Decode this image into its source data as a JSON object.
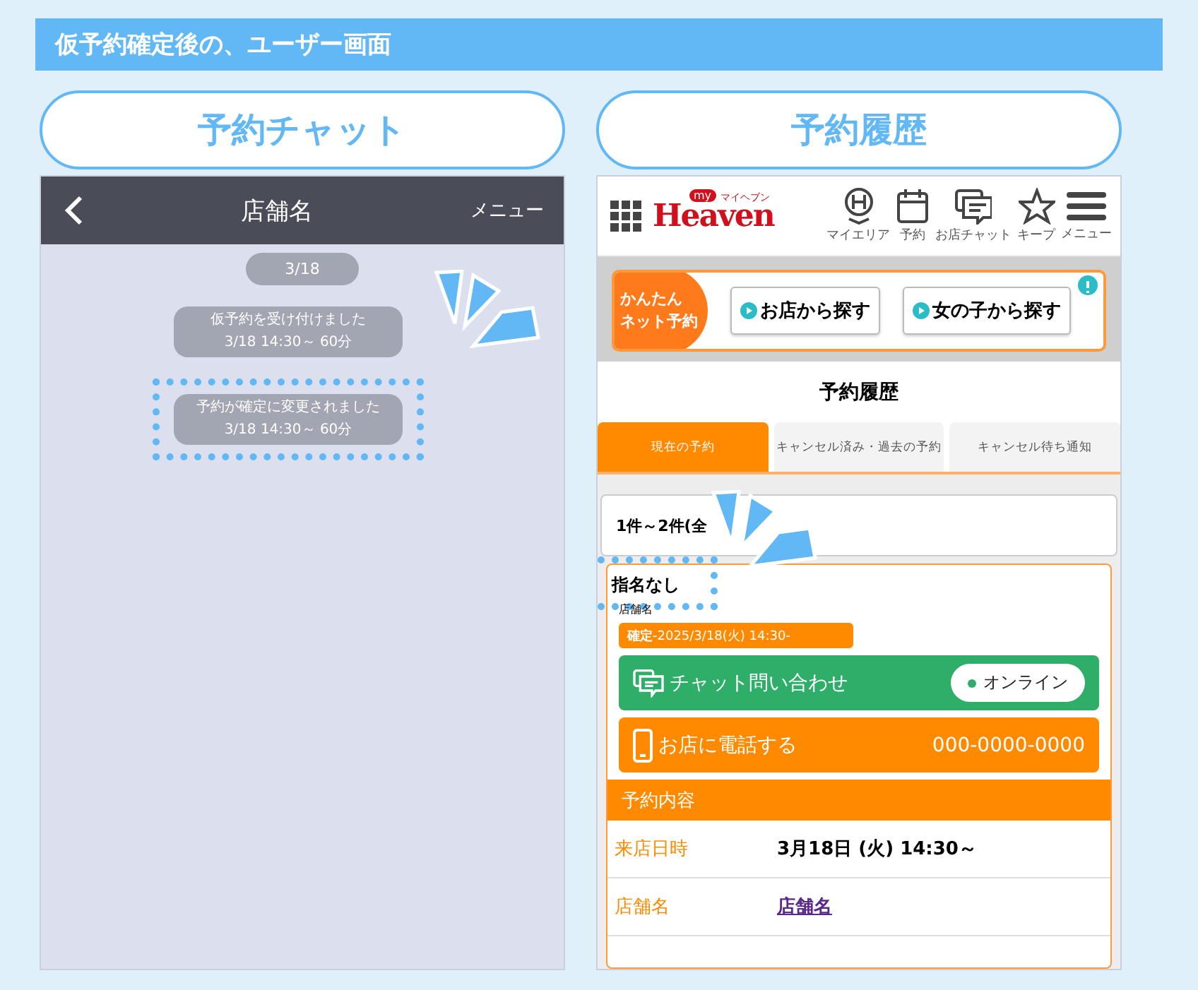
{
  "banner": {
    "title": "仮予約確定後の、ユーザー画面"
  },
  "chat": {
    "heading": "予約チャット",
    "title": "店舗名",
    "menu": "メニュー",
    "date": "3/18",
    "messages": [
      {
        "lines": [
          "仮予約を受け付けました",
          "3/18 14:30～ 60分"
        ],
        "highlighted": false
      },
      {
        "lines": [
          "予約が確定に変更されました",
          "3/18 14:30～ 60分"
        ],
        "highlighted": true
      }
    ]
  },
  "history": {
    "heading": "予約履歴",
    "logo": {
      "small": "my",
      "name": "Heaven",
      "kana": "マイヘブン"
    },
    "nav": [
      {
        "kind": "pin",
        "label": "マイエリア"
      },
      {
        "kind": "calendar",
        "label": "予約"
      },
      {
        "kind": "chat",
        "label": "お店チャット"
      },
      {
        "kind": "star",
        "label": "キープ"
      },
      {
        "kind": "menu",
        "label": "メニュー"
      }
    ],
    "promo": {
      "badge": [
        "かんたん",
        "ネット予約"
      ],
      "buttons": [
        "お店から探す",
        "女の子から探す"
      ]
    },
    "page_title": "予約履歴",
    "tabs": [
      {
        "label": "現在の予約",
        "selected": true
      },
      {
        "label": "キャンセル済み・過去の予約",
        "selected": false
      },
      {
        "label": "キャンセル待ち通知",
        "selected": false
      }
    ],
    "count": "1件～2件(全",
    "reservation": {
      "nomination": "指名なし",
      "shop": "店舗名",
      "status": "**確定**-2025/3/18(火) 14:30-",
      "chat_button": "チャット問い合わせ",
      "online": "オンライン",
      "phone_button": "お店に電話する",
      "phone": "000-0000-0000",
      "details_heading": "予約内容",
      "details": [
        {
          "kind": "text",
          "label": "来店日時",
          "value": "3月18日 (火) 14:30～"
        },
        {
          "kind": "link",
          "label": "店舗名",
          "value": "店舗名"
        }
      ]
    }
  }
}
